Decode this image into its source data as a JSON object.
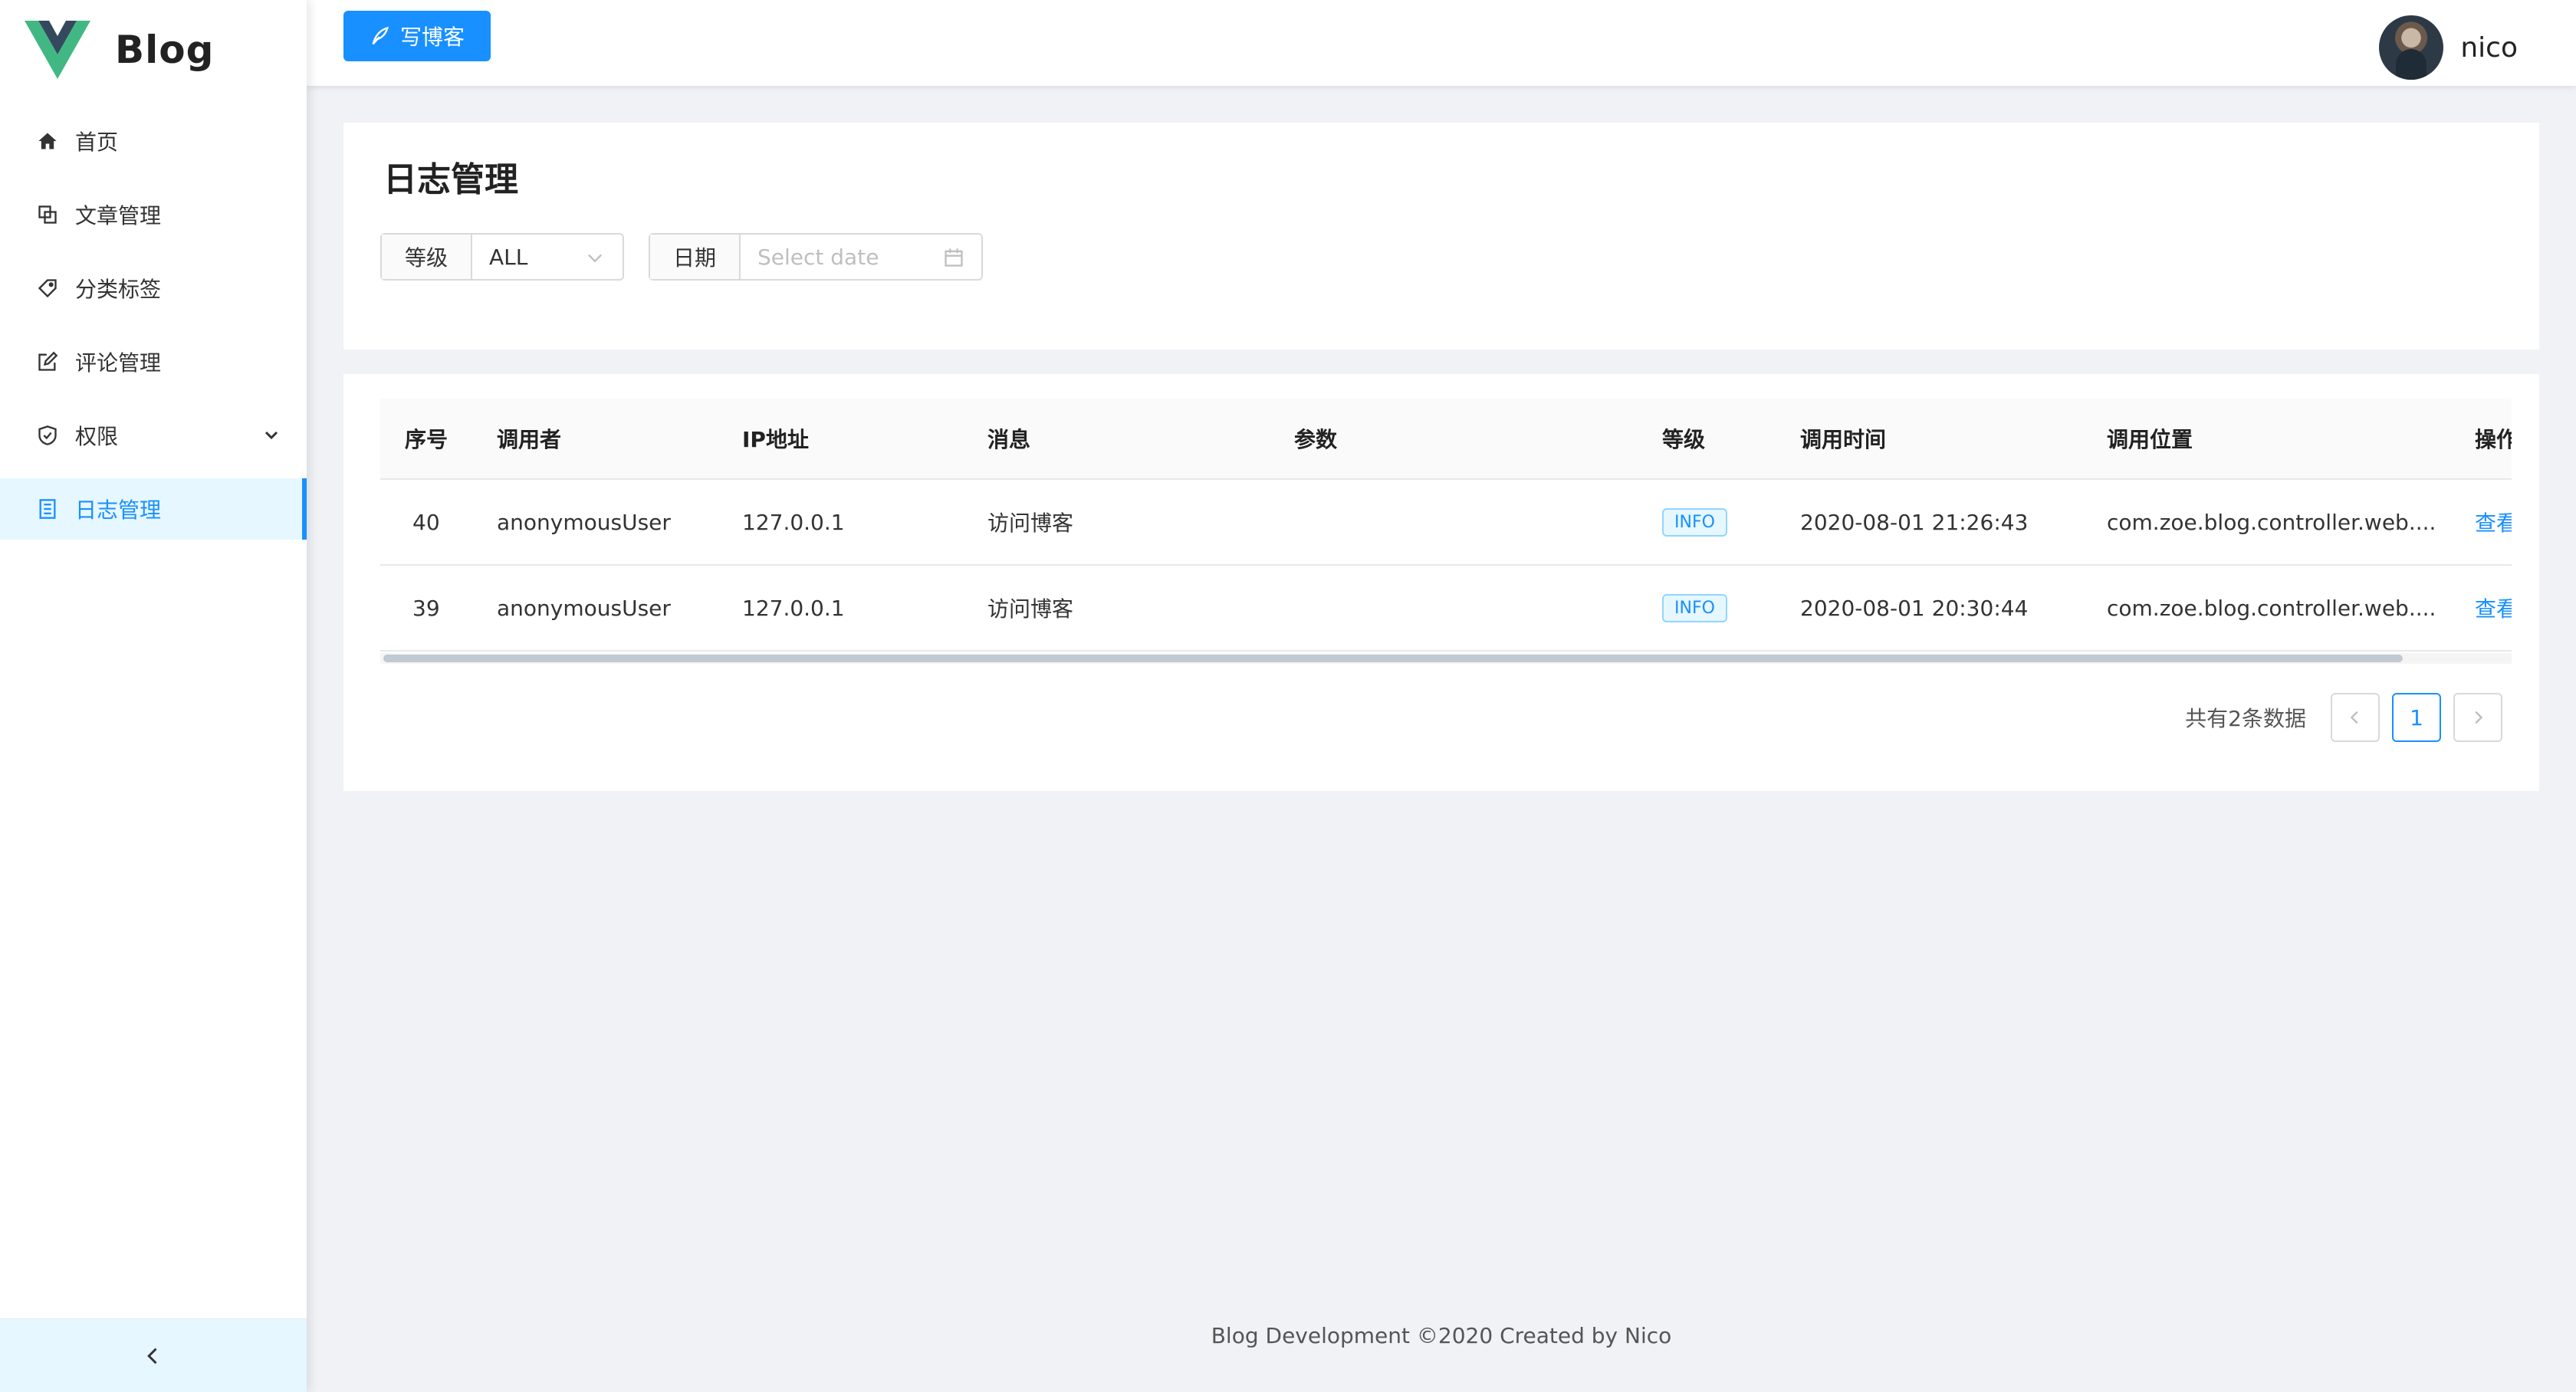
{
  "app": {
    "name": "Blog"
  },
  "header": {
    "write_button": "写博客",
    "username": "nico"
  },
  "sidebar": {
    "items": [
      {
        "label": "首页",
        "icon": "home-icon"
      },
      {
        "label": "文章管理",
        "icon": "copy-icon"
      },
      {
        "label": "分类标签",
        "icon": "tag-icon"
      },
      {
        "label": "评论管理",
        "icon": "edit-icon"
      },
      {
        "label": "权限",
        "icon": "shield-icon",
        "expandable": true
      },
      {
        "label": "日志管理",
        "icon": "log-icon",
        "active": true
      }
    ]
  },
  "page": {
    "title": "日志管理"
  },
  "filters": {
    "level_label": "等级",
    "level_value": "ALL",
    "date_label": "日期",
    "date_placeholder": "Select date"
  },
  "table": {
    "columns": [
      "序号",
      "调用者",
      "IP地址",
      "消息",
      "参数",
      "等级",
      "调用时间",
      "调用位置",
      "操作"
    ],
    "rows": [
      {
        "id": "40",
        "caller": "anonymousUser",
        "ip": "127.0.0.1",
        "message": "访问博客",
        "params": "",
        "level": "INFO",
        "time": "2020-08-01 21:26:43",
        "location": "com.zoe.blog.controller.web....",
        "action": "查看"
      },
      {
        "id": "39",
        "caller": "anonymousUser",
        "ip": "127.0.0.1",
        "message": "访问博客",
        "params": "",
        "level": "INFO",
        "time": "2020-08-01 20:30:44",
        "location": "com.zoe.blog.controller.web....",
        "action": "查看"
      }
    ]
  },
  "pagination": {
    "total_text": "共有2条数据",
    "current_page": "1"
  },
  "footer": {
    "text": "Blog Development ©2020 Created by Nico"
  },
  "colors": {
    "primary": "#1890ff",
    "active_bg": "#e6f7ff",
    "logo_green": "#41b883",
    "logo_dark": "#35495e"
  }
}
